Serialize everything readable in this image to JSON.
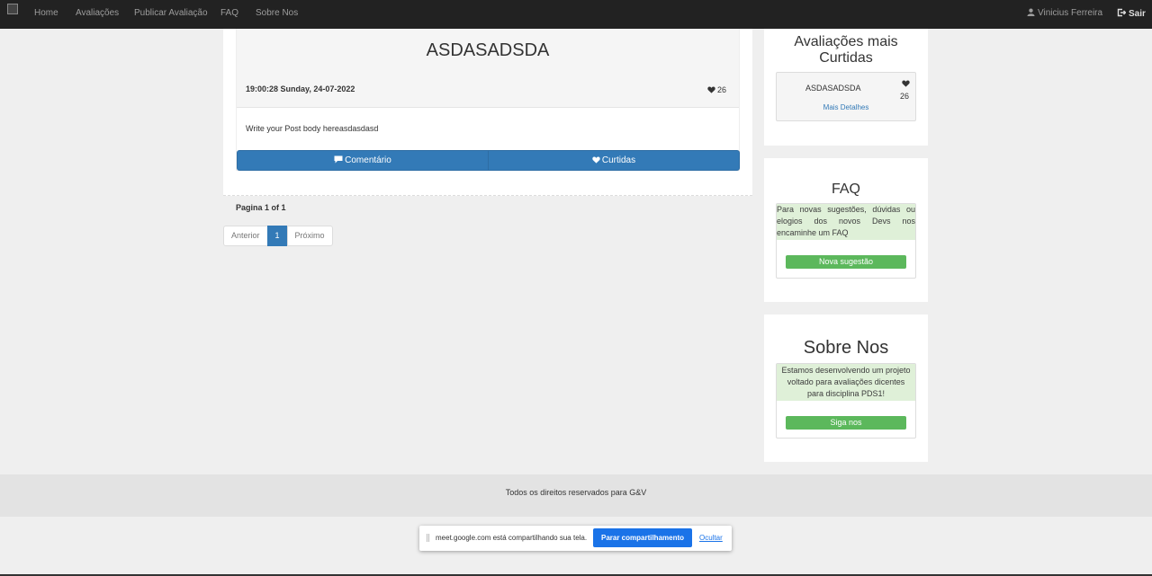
{
  "navbar": {
    "links": [
      "Home",
      "Avaliações",
      "Publicar Avaliação",
      "FAQ",
      "Sobre Nos"
    ],
    "user_name": "Vinicius Ferreira",
    "logout": "Sair"
  },
  "post": {
    "title": "ASDASADSDA",
    "datetime": "19:00:28 Sunday, 24-07-2022",
    "likes": "26",
    "body": "Write your Post body hereasdasdasd",
    "comment_button": "Comentário",
    "likes_button": "Curtidas"
  },
  "pagination": {
    "info": "Pagina 1 of 1",
    "prev": "Anterior",
    "current": "1",
    "next": "Próximo"
  },
  "sidebar": {
    "top_liked": {
      "title": "Avaliações mais Curtidas",
      "item_title": "ASDASADSDA",
      "item_likes": "26",
      "details_link": "Mais Detalhes"
    },
    "faq": {
      "title": "FAQ",
      "text": "Para novas sugestões, dúvidas ou elogios dos novos Devs nos encaminhe um FAQ",
      "button": "Nova sugestão"
    },
    "about": {
      "title": "Sobre Nos",
      "text": "Estamos desenvolvendo um projeto voltado para avaliações dicentes para disciplina PDS1!",
      "button": "Siga nos"
    }
  },
  "footer": {
    "text": "Todos os direitos reservados para G&V"
  },
  "share_bar": {
    "text": "meet.google.com está compartilhando sua tela.",
    "stop_button": "Parar compartilhamento",
    "hide_link": "Ocultar"
  },
  "colors": {
    "navbar": "#222222",
    "primary": "#337ab7",
    "success": "#5cb85c",
    "success_bg": "#dff0d8",
    "google_blue": "#1a73e8"
  }
}
